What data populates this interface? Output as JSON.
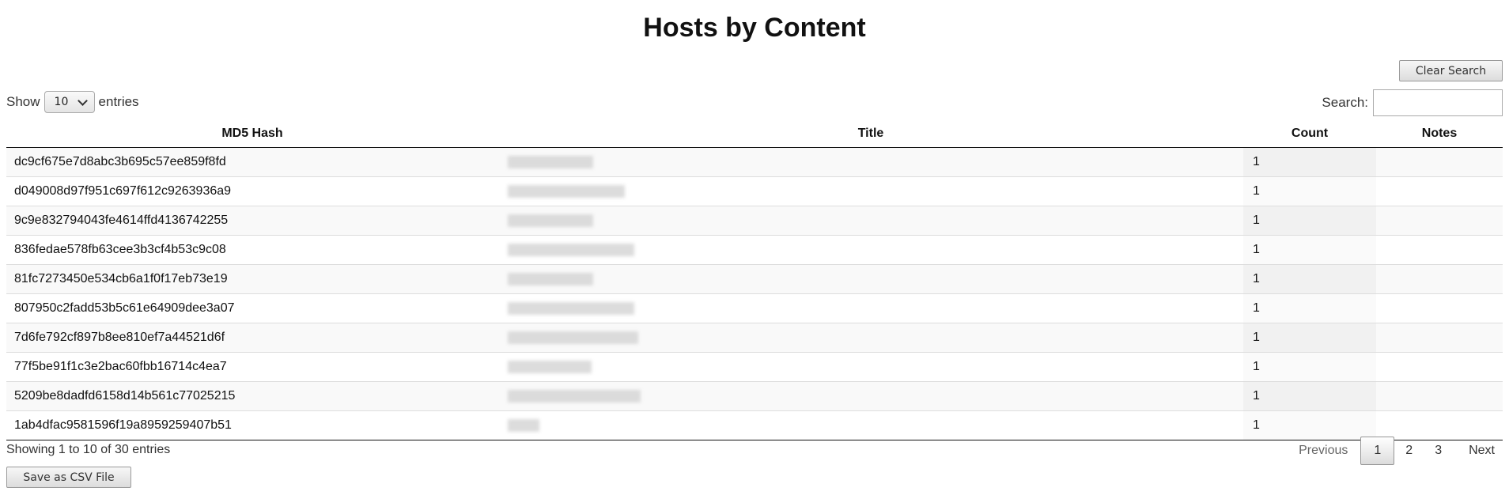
{
  "page": {
    "title": "Hosts by Content"
  },
  "toolbar": {
    "clear_search_label": "Clear Search",
    "save_csv_label": "Save as CSV File"
  },
  "length": {
    "prefix": "Show",
    "value": "10",
    "suffix": "entries"
  },
  "search": {
    "label": "Search:",
    "value": "",
    "placeholder": ""
  },
  "table": {
    "headers": {
      "hash": "MD5 Hash",
      "title": "Title",
      "count": "Count",
      "notes": "Notes"
    },
    "rows": [
      {
        "hash": "dc9cf675e7d8abc3b695c57ee859f8fd",
        "count": "1"
      },
      {
        "hash": "d049008d97f951c697f612c9263936a9",
        "count": "1"
      },
      {
        "hash": "9c9e832794043fe4614ffd4136742255",
        "count": "1"
      },
      {
        "hash": "836fedae578fb63cee3b3cf4b53c9c08",
        "count": "1"
      },
      {
        "hash": "81fc7273450e534cb6a1f0f17eb73e19",
        "count": "1"
      },
      {
        "hash": "807950c2fadd53b5c61e64909dee3a07",
        "count": "1"
      },
      {
        "hash": "7d6fe792cf897b8ee810ef7a44521d6f",
        "count": "1"
      },
      {
        "hash": "77f5be91f1c3e2bac60fbb16714c4ea7",
        "count": "1"
      },
      {
        "hash": "5209be8dadfd6158d14b561c77025215",
        "count": "1"
      },
      {
        "hash": "1ab4dfac9581596f19a8959259407b51",
        "count": "1"
      }
    ]
  },
  "info": {
    "text": "Showing 1 to 10 of 30 entries"
  },
  "pagination": {
    "previous": "Previous",
    "pages": [
      "1",
      "2",
      "3"
    ],
    "current": "1",
    "next": "Next"
  }
}
